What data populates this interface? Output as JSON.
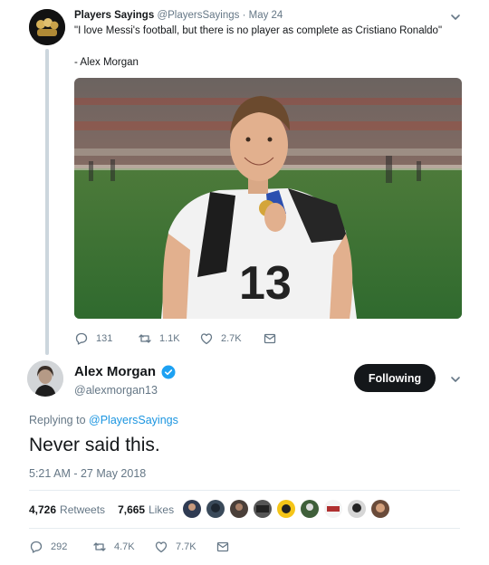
{
  "original_tweet": {
    "display_name": "Players Sayings",
    "handle": "@PlayersSayings",
    "separator": " · ",
    "date": "May 24",
    "quote_text": "\"I love Messi's football, but there is no player as complete as Cristiano Ronaldo\"",
    "attribution": "- Alex Morgan",
    "media_icon": "photo-of-player-holding-medal",
    "actions": {
      "replies": "131",
      "retweets": "1.1K",
      "likes": "2.7K"
    }
  },
  "reply_tweet": {
    "display_name": "Alex Morgan",
    "handle": "@alexmorgan13",
    "verified": true,
    "follow_button_label": "Following",
    "replying_prefix": "Replying to ",
    "replying_to": "@PlayersSayings",
    "text": "Never said this.",
    "timestamp": "5:21 AM - 27 May 2018",
    "stats": {
      "retweets_count": "4,726",
      "retweets_label": "Retweets",
      "likes_count": "7,665",
      "likes_label": "Likes"
    },
    "actions": {
      "replies": "292",
      "retweets": "4.7K",
      "likes": "7.7K"
    }
  },
  "colors": {
    "accent_blue": "#1da1f2",
    "link_blue": "#1b95e0",
    "secondary_text": "#657786",
    "follow_button_bg": "#14171a",
    "thread_line": "#ccd6dd"
  }
}
